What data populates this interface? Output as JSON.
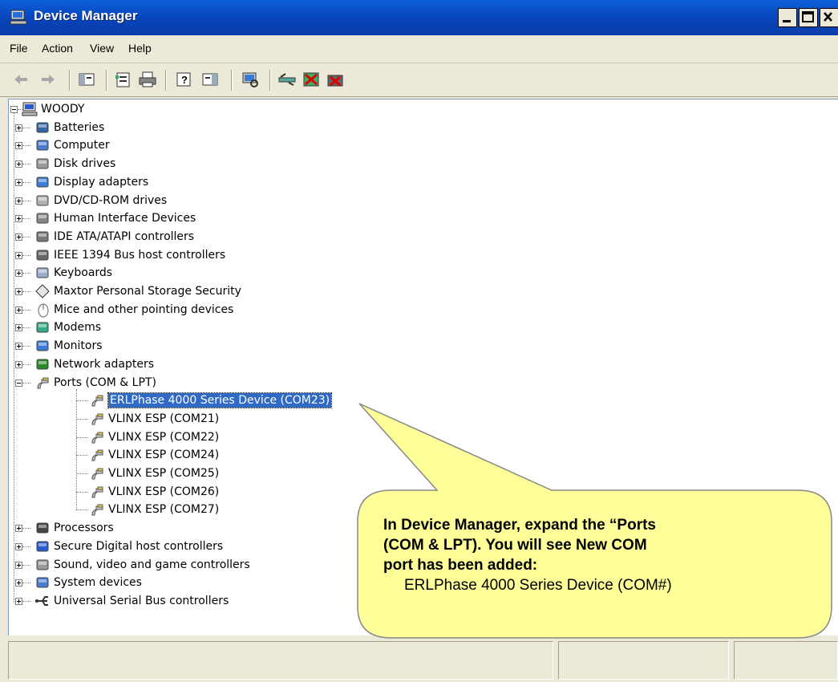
{
  "window": {
    "title": "Device Manager"
  },
  "menu": {
    "items": [
      "File",
      "Action",
      "View",
      "Help"
    ]
  },
  "toolbar": {
    "icons": [
      "back-arrow-icon",
      "forward-arrow-icon",
      "show-hide-console-tree-icon",
      "properties-icon",
      "print-icon",
      "help-icon",
      "show-hide-action-pane-icon",
      "scan-hardware-icon",
      "update-driver-icon",
      "disable-device-icon",
      "uninstall-device-icon"
    ]
  },
  "tree": {
    "root": "WOODY",
    "categories": [
      {
        "label": "Batteries",
        "icon": "battery-icon"
      },
      {
        "label": "Computer",
        "icon": "computer-icon"
      },
      {
        "label": "Disk drives",
        "icon": "disk-drive-icon"
      },
      {
        "label": "Display adapters",
        "icon": "display-adapter-icon"
      },
      {
        "label": "DVD/CD-ROM drives",
        "icon": "dvd-drive-icon"
      },
      {
        "label": "Human Interface Devices",
        "icon": "hid-icon"
      },
      {
        "label": "IDE ATA/ATAPI controllers",
        "icon": "ide-controller-icon"
      },
      {
        "label": "IEEE 1394 Bus host controllers",
        "icon": "ieee1394-icon"
      },
      {
        "label": "Keyboards",
        "icon": "keyboard-icon"
      },
      {
        "label": "Maxtor Personal Storage Security",
        "icon": "maxtor-icon"
      },
      {
        "label": "Mice and other pointing devices",
        "icon": "mouse-icon"
      },
      {
        "label": "Modems",
        "icon": "modem-icon"
      },
      {
        "label": "Monitors",
        "icon": "monitor-icon"
      },
      {
        "label": "Network adapters",
        "icon": "network-adapter-icon"
      },
      {
        "label": "Ports (COM & LPT)",
        "icon": "port-icon"
      }
    ],
    "ports": [
      "ERLPhase 4000 Series Device (COM23)",
      "VLINX ESP (COM21)",
      "VLINX ESP (COM22)",
      "VLINX ESP (COM24)",
      "VLINX ESP (COM25)",
      "VLINX ESP (COM26)",
      "VLINX ESP (COM27)"
    ],
    "categories_after": [
      {
        "label": "Processors",
        "icon": "processor-icon"
      },
      {
        "label": "Secure Digital host controllers",
        "icon": "sd-controller-icon"
      },
      {
        "label": "Sound, video and game controllers",
        "icon": "sound-icon"
      },
      {
        "label": "System devices",
        "icon": "system-device-icon"
      },
      {
        "label": "Universal Serial Bus controllers",
        "icon": "usb-icon"
      }
    ]
  },
  "callout": {
    "line1": "In Device Manager, expand the “Ports",
    "line2": "(COM & LPT). You will see New COM",
    "line3": "port has been added:",
    "line4": "ERLPhase 4000 Series Device (COM#)",
    "fill": "#ffff99"
  },
  "colors": {
    "titlebar": "#0842b8",
    "selection": "#316ac5",
    "chrome": "#ece9d8"
  }
}
